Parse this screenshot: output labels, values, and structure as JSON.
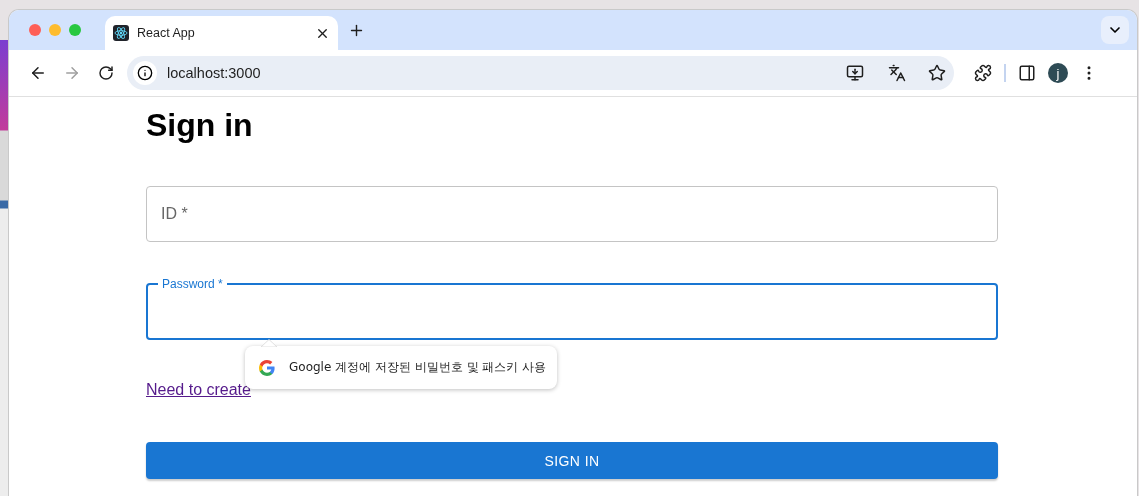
{
  "browser": {
    "tabs": [
      {
        "title": "React App",
        "selected": true
      }
    ],
    "address": "localhost:3000",
    "forward_disabled": true,
    "profile_initial": "j"
  },
  "page": {
    "title": "Sign in",
    "fields": [
      {
        "label": "ID *",
        "focused": false
      },
      {
        "label": "Password *",
        "focused": true
      }
    ],
    "link": "Need to create",
    "button": "SIGN IN"
  },
  "autofill_popup": {
    "text": "Google 계정에 저장된 비밀번호 및 패스키 사용"
  }
}
